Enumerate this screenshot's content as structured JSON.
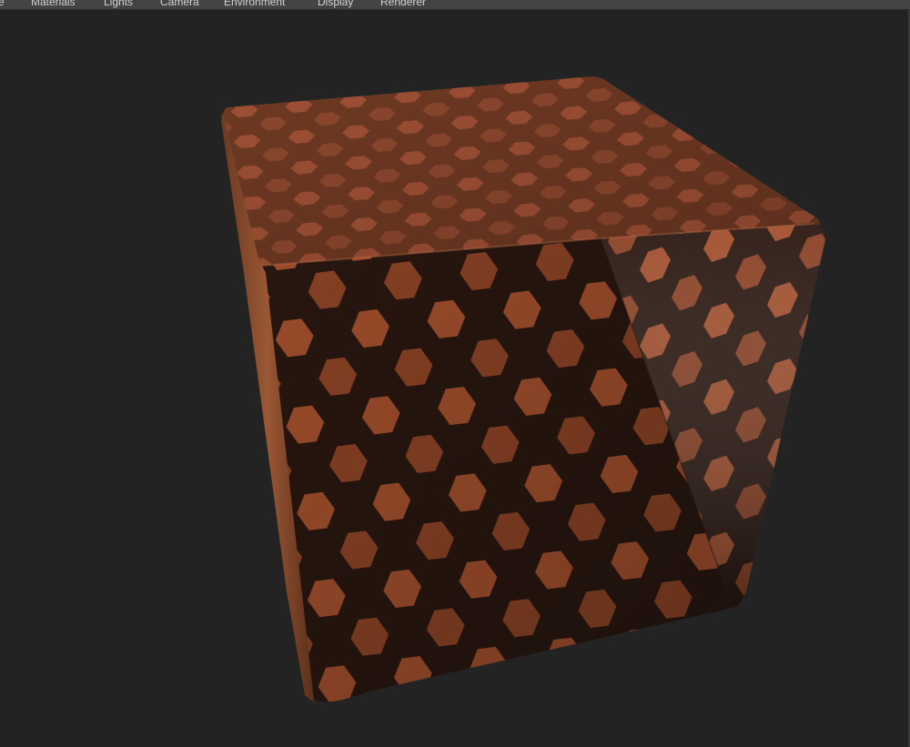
{
  "menubar": {
    "items": [
      {
        "label": "e"
      },
      {
        "label": "Materials"
      },
      {
        "label": "Lights"
      },
      {
        "label": "Camera"
      },
      {
        "label": "Environment"
      },
      {
        "label": "Display"
      },
      {
        "label": "Renderer"
      }
    ]
  },
  "viewport": {
    "background": "#232323",
    "object": "hexagon-tile-cube",
    "tile_color": "#b0562e",
    "grout_color": "#2a1710"
  }
}
